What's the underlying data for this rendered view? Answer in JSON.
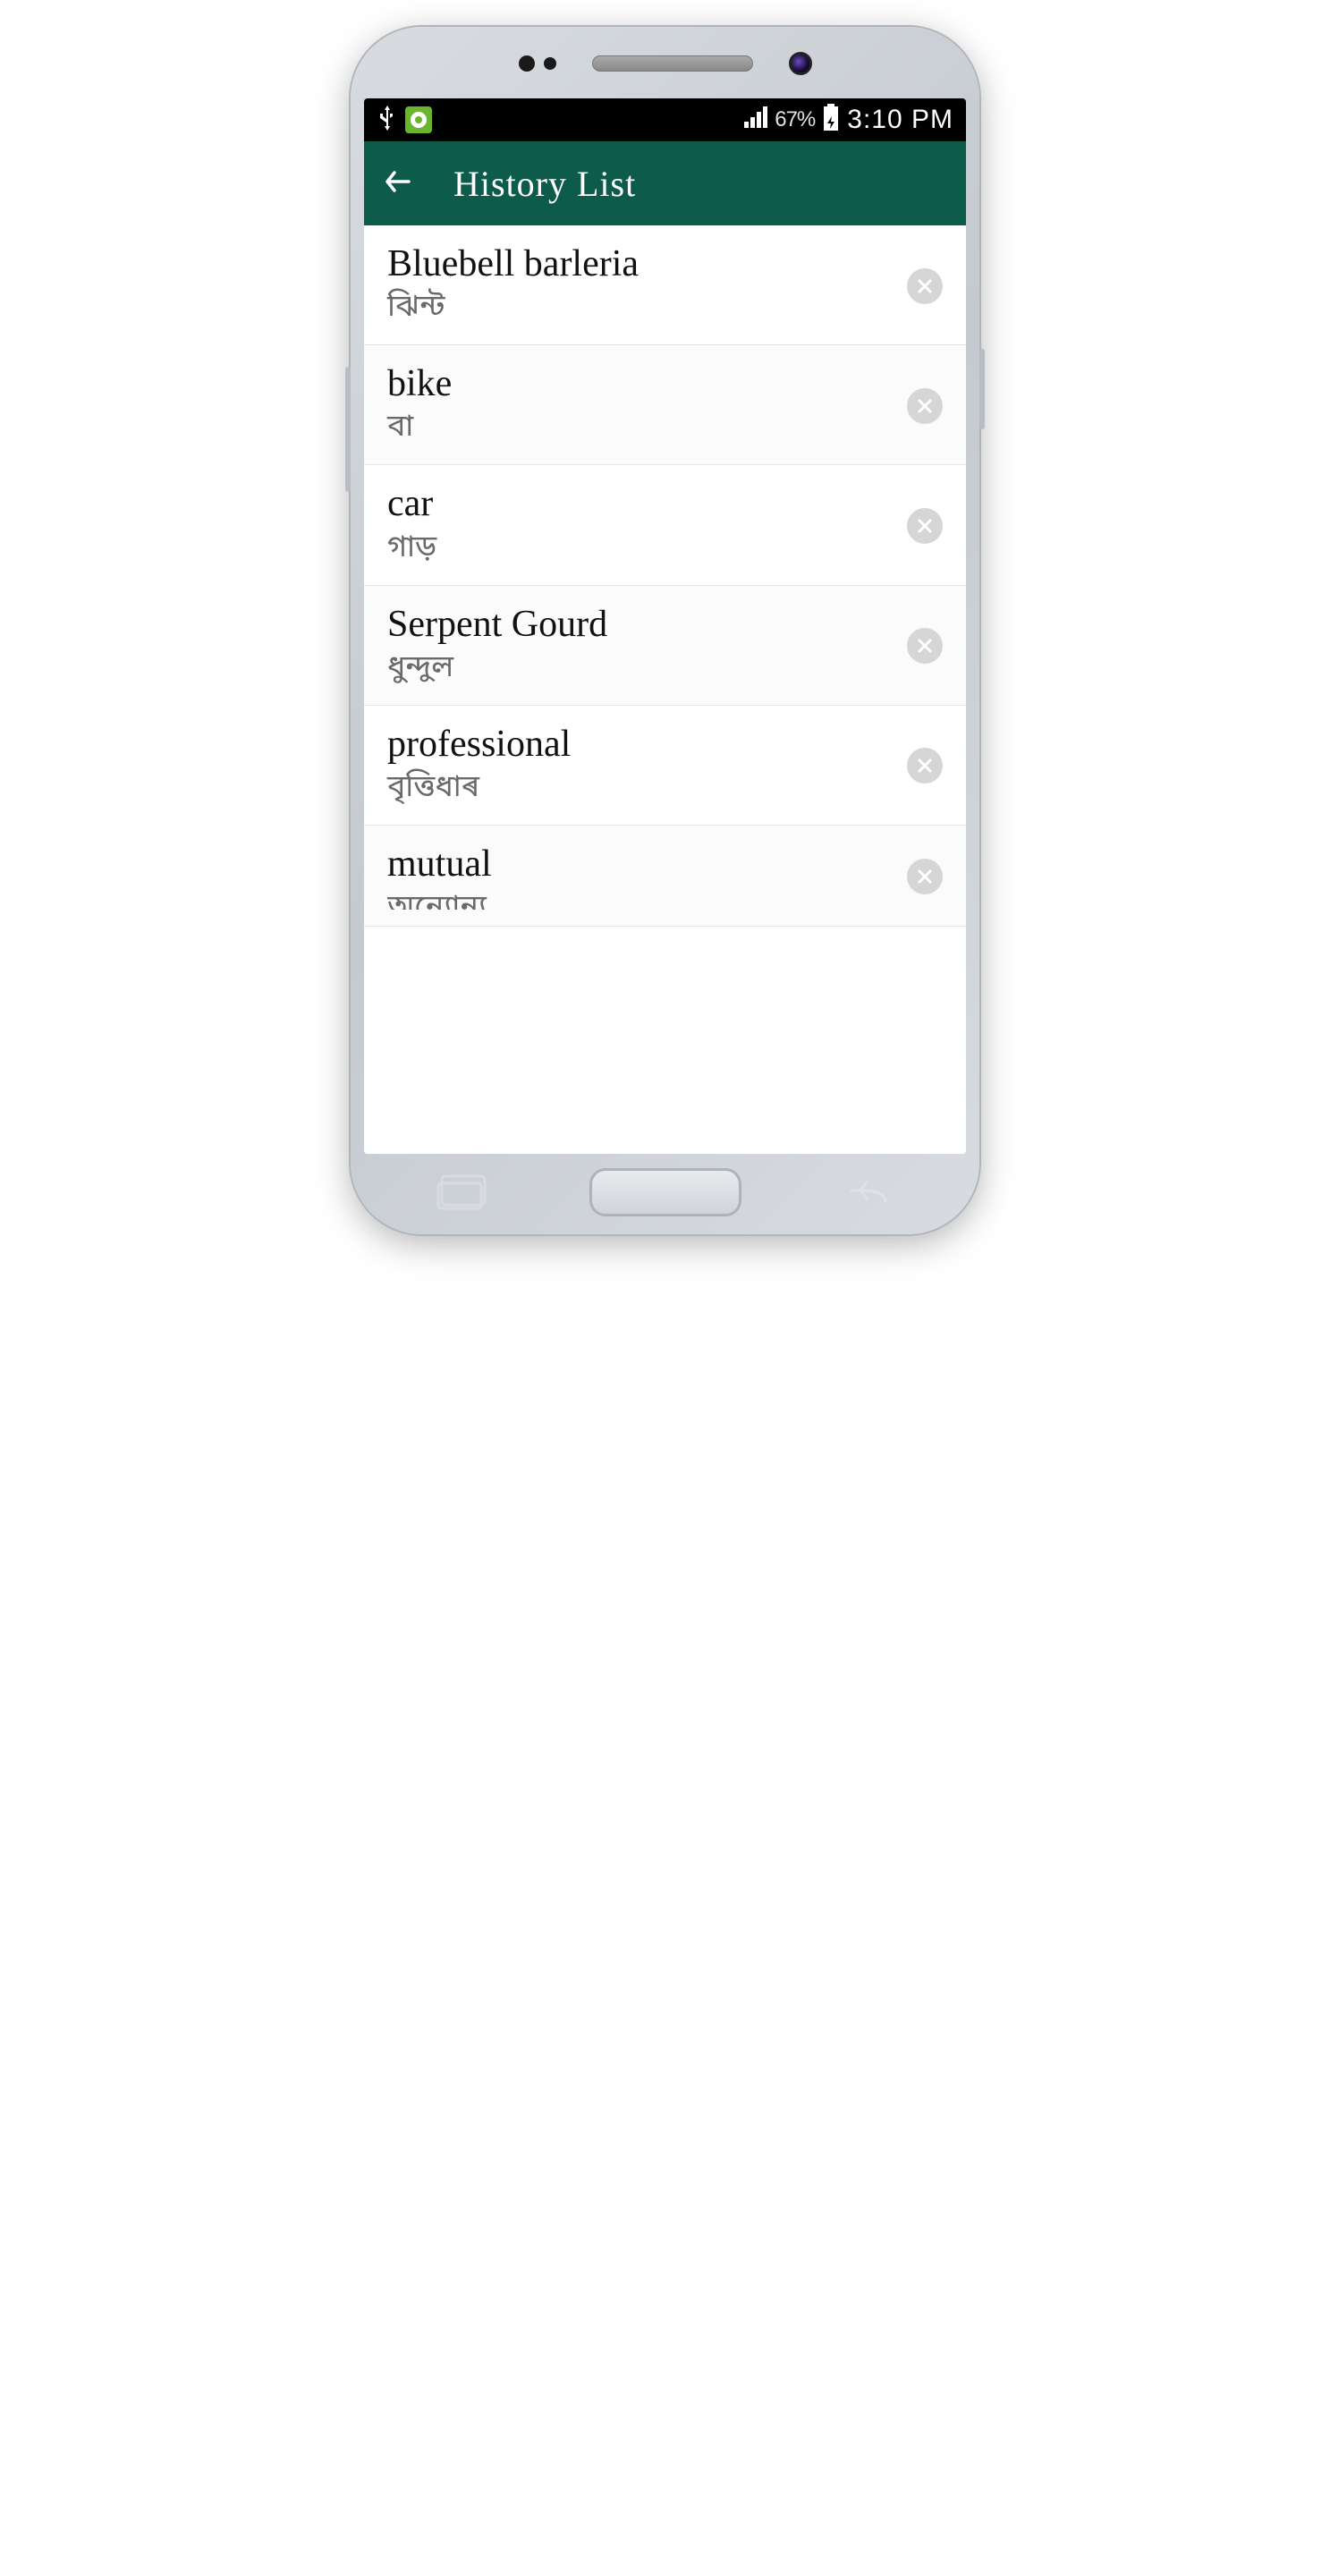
{
  "status_bar": {
    "battery_pct": "67%",
    "time": "3:10 PM"
  },
  "app_bar": {
    "title": "History List"
  },
  "history": [
    {
      "primary": "Bluebell barleria",
      "secondary": "ঝিন্ট"
    },
    {
      "primary": "bike",
      "secondary": "বা"
    },
    {
      "primary": "car",
      "secondary": "গাড়"
    },
    {
      "primary": "Serpent Gourd",
      "secondary": "ধুন্দুল"
    },
    {
      "primary": "professional",
      "secondary": "বৃত্তিধাৰ"
    },
    {
      "primary": "mutual",
      "secondary": "অন্যোন্য"
    }
  ]
}
